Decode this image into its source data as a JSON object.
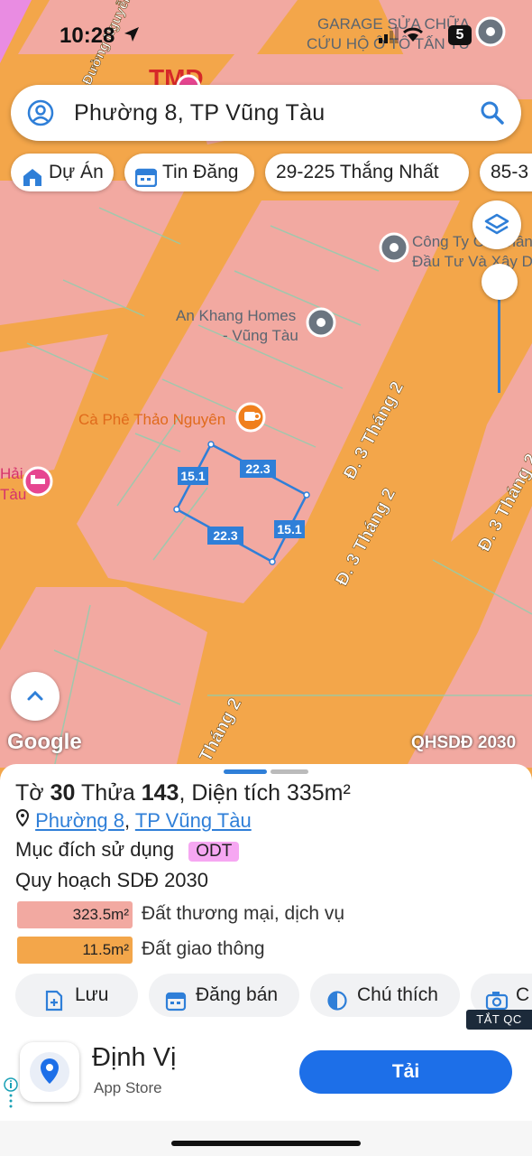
{
  "status_bar": {
    "time": "10:28",
    "battery": "5"
  },
  "search": {
    "value": "Phường 8, TP Vũng Tàu"
  },
  "chips": [
    {
      "label": "Dự Án",
      "icon": "house-icon"
    },
    {
      "label": "Tin Đăng",
      "icon": "calendar-icon"
    },
    {
      "label": "29-225 Thắng Nhất",
      "icon": ""
    },
    {
      "label": "85-3",
      "icon": ""
    }
  ],
  "map": {
    "pois": [
      {
        "name_line1": "GARAGE SỬA CHỮA",
        "name_line2": "CỨU HỘ Ô TÔ TẤN TÚ",
        "icon": "pin-icon"
      },
      {
        "name_line1": "Công Ty Cổ Phần",
        "name_line2": "Đầu Tư Và Xây Dựng",
        "icon": "pin-icon"
      },
      {
        "name_line1": "An Khang Homes",
        "name_line2": "- Vũng Tàu",
        "icon": "pin-icon"
      },
      {
        "name_line1": "Cà Phê Thảo Nguyên",
        "name_line2": "",
        "icon": "coffee-icon"
      },
      {
        "name_line1": "Hải",
        "name_line2": "Tàu",
        "icon": "hotel-icon"
      }
    ],
    "tmd_label": "TMD",
    "street_labels": [
      "Đ. 3 Tháng 2",
      "Đ. 3 Tháng 2",
      "Đ. 3 Tháng 2",
      "Tháng 2",
      "Đường Nguyễn"
    ],
    "parcel_dims": {
      "top": "22.3",
      "left": "15.1",
      "bottom": "22.3",
      "right": "15.1"
    },
    "attribution": "Google",
    "plan_label": "QHSDĐ 2030",
    "colors": {
      "road": "#f3a64a",
      "commercial": "#f2a9a1",
      "parcel_outline": "#2f7fd8"
    }
  },
  "sheet": {
    "title_parts": {
      "to_label": "Tờ",
      "to": "30",
      "thua_label": "Thửa",
      "thua": "143",
      "area_label": "Diện tích",
      "area": "335m²"
    },
    "ward": "Phường 8",
    "city": "TP Vũng Tàu",
    "purpose_label": "Mục đích sử dụng",
    "purpose_code": "ODT",
    "plan_title": "Quy hoạch SDĐ 2030",
    "areas": [
      {
        "value": "323.5m²",
        "label": "Đất thương mại, dịch vụ",
        "color": "#f2a9a1"
      },
      {
        "value": "11.5m²",
        "label": "Đất giao thông",
        "color": "#f3a64a"
      }
    ],
    "actions": [
      {
        "label": "Lưu",
        "icon": "save-add-icon"
      },
      {
        "label": "Đăng bán",
        "icon": "calendar-icon"
      },
      {
        "label": "Chú thích",
        "icon": "contrast-icon"
      },
      {
        "label": "C",
        "icon": "camera-icon"
      }
    ]
  },
  "ad": {
    "close_label": "TẮT QC",
    "title": "Định Vị",
    "subtitle": "App Store",
    "cta": "Tải"
  }
}
